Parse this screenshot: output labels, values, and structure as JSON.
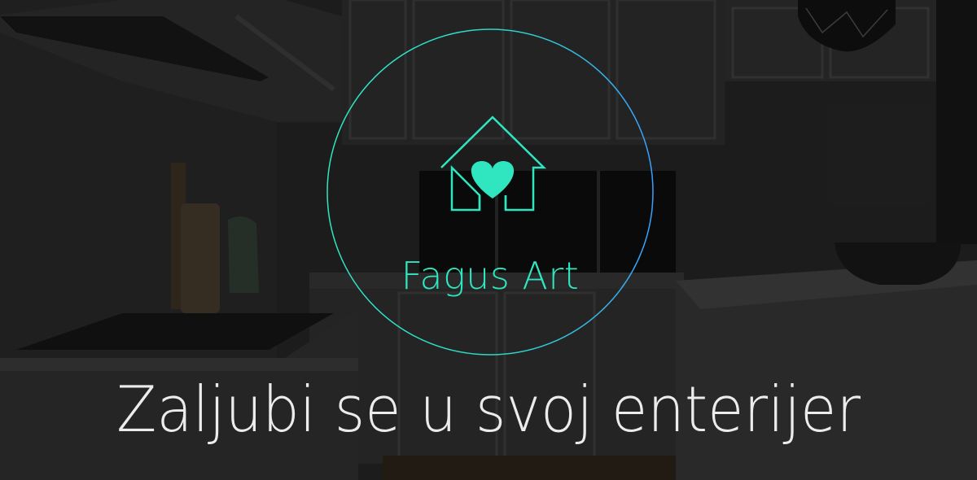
{
  "hero": {
    "brand_name": "Fagus Art",
    "tagline": "Zaljubi se u svoj enterijer"
  },
  "logo": {
    "icon": "house-heart-icon",
    "accent_color": "#2fe6c0",
    "ring_color_end": "#3aa0ff"
  },
  "background": {
    "icon": "kitchen-photo-background"
  }
}
